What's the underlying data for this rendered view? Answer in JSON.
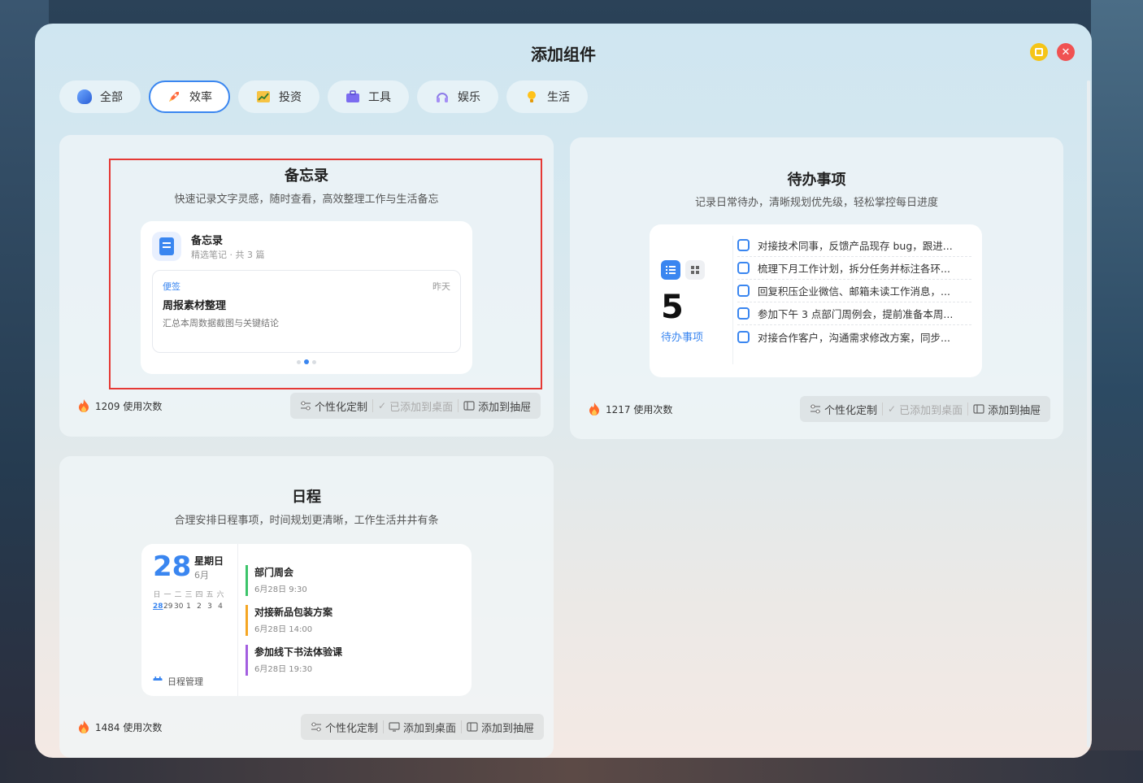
{
  "dialog": {
    "title": "添加组件"
  },
  "tabs": [
    {
      "label": "全部",
      "icon": "all-icon",
      "active": false
    },
    {
      "label": "效率",
      "icon": "rocket-icon",
      "active": true
    },
    {
      "label": "投资",
      "icon": "chart-icon",
      "active": false
    },
    {
      "label": "工具",
      "icon": "toolbox-icon",
      "active": false
    },
    {
      "label": "娱乐",
      "icon": "headphones-icon",
      "active": false
    },
    {
      "label": "生活",
      "icon": "lightbulb-icon",
      "active": false
    }
  ],
  "cards": {
    "memo": {
      "title": "备忘录",
      "desc": "快速记录文字灵感，随时查看，高效整理工作与生活备忘",
      "widget": {
        "name": "备忘录",
        "sub": "精选笔记 · 共 3 篇",
        "tag": "便签",
        "date": "昨天",
        "note_title": "周报素材整理",
        "note_body": "汇总本周数据截图与关键结论"
      },
      "usage": "1209 使用次数",
      "actions": {
        "customize": "个性化定制",
        "desktop": "已添加到桌面",
        "drawer": "添加到抽屉"
      }
    },
    "todo": {
      "title": "待办事项",
      "desc": "记录日常待办，清晰规划优先级，轻松掌控每日进度",
      "widget": {
        "count": "5",
        "count_label": "待办事项",
        "items": [
          "对接技术同事，反馈产品现存 bug，跟进...",
          "梳理下月工作计划，拆分任务并标注各环...",
          "回复积压企业微信、邮箱未读工作消息，...",
          "参加下午 3 点部门周例会，提前准备本周...",
          "对接合作客户，沟通需求修改方案，同步..."
        ]
      },
      "usage": "1217 使用次数",
      "actions": {
        "customize": "个性化定制",
        "desktop": "已添加到桌面",
        "drawer": "添加到抽屉"
      }
    },
    "schedule": {
      "title": "日程",
      "desc": "合理安排日程事项，时间规划更清晰，工作生活井井有条",
      "widget": {
        "day": "28",
        "weekday": "星期日",
        "month": "6月",
        "week_header": [
          "日",
          "一",
          "二",
          "三",
          "四",
          "五",
          "六"
        ],
        "week_days": [
          "28",
          "29",
          "30",
          "1",
          "2",
          "3",
          "4"
        ],
        "manage_label": "日程管理",
        "events": [
          {
            "title": "部门周会",
            "time": "6月28日 9:30",
            "color": "#3cc46a"
          },
          {
            "title": "对接新品包装方案",
            "time": "6月28日 14:00",
            "color": "#f5a623"
          },
          {
            "title": "参加线下书法体验课",
            "time": "6月28日 19:30",
            "color": "#a35ee0"
          }
        ]
      },
      "usage": "1484 使用次数",
      "actions": {
        "customize": "个性化定制",
        "desktop": "添加到桌面",
        "drawer": "添加到抽屉"
      }
    }
  },
  "colors": {
    "accent": "#3a86f0",
    "close": "#f05252",
    "maximize": "#f5c518",
    "highlight": "#e53935"
  }
}
